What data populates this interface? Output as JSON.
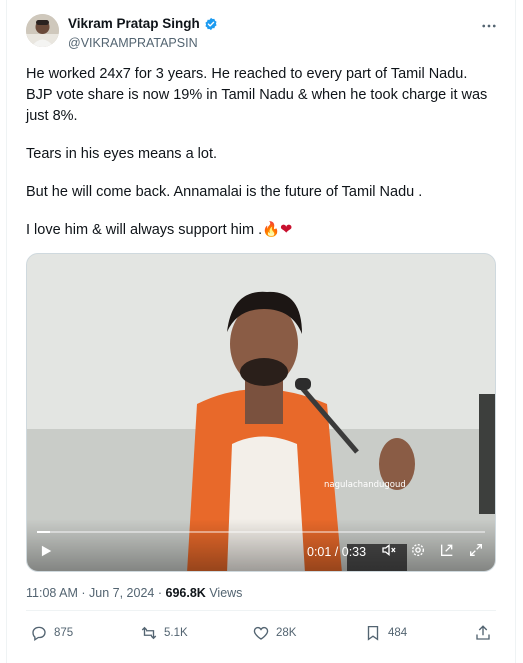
{
  "author": {
    "display_name": "Vikram Pratap Singh",
    "handle": "@VIKRAMPRATAPSIN",
    "verified": true,
    "avatar_icon": "person-avatar"
  },
  "tweet": {
    "paragraphs": [
      "He worked 24x7 for 3 years. He reached to every part of Tamil Nadu. BJP vote share is now 19% in Tamil Nadu & when he took charge it was just 8%.",
      "Tears in his eyes means a lot.",
      "But he will come back. Annamalai is the future of Tamil Nadu .",
      "I love him & will always support him ."
    ],
    "emojis": [
      "🔥",
      "❤"
    ]
  },
  "video": {
    "watermark": "nagulachandugoud",
    "time_display": "0:01 / 0:33",
    "progress_fraction": 0.03
  },
  "meta": {
    "time": "11:08 AM",
    "date": "Jun 7, 2024",
    "separator": "·",
    "views_count": "696.8K",
    "views_label": "Views"
  },
  "actions": {
    "replies": "875",
    "reposts": "5.1K",
    "likes": "28K",
    "bookmarks": "484"
  },
  "colors": {
    "text_primary": "#0f1419",
    "text_secondary": "#536471",
    "verified_blue": "#1d9bf0",
    "saffron": "#e8692a"
  }
}
